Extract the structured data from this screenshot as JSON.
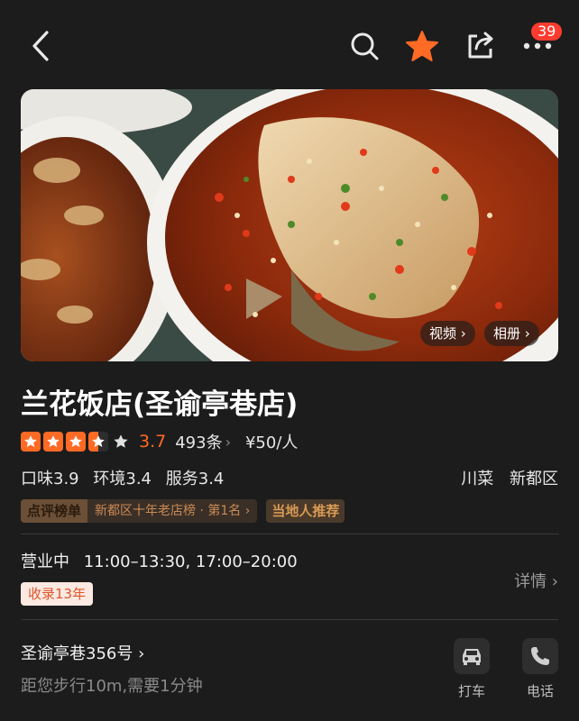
{
  "topbar": {
    "back_icon": "chevron-left-icon",
    "search_icon": "search-icon",
    "favorite_icon": "star-icon",
    "share_icon": "share-icon",
    "more_icon": "more-icon",
    "notification_count": "39",
    "accent_color": "#ff6a25"
  },
  "hero": {
    "video_label": "视频 ›",
    "album_label": "相册 ›"
  },
  "shop": {
    "name": "兰花饭店(圣谕亭巷店)",
    "stars": 3.5,
    "score": "3.7",
    "reviews": "493条",
    "price": "¥50/人",
    "taste": "口味3.9",
    "environment": "环境3.4",
    "service": "服务3.4",
    "category": "川菜",
    "district": "新都区"
  },
  "tags": {
    "rank_label": "点评榜单",
    "rank_text": "新都区十年老店榜 · 第1名 ›",
    "local_label": "当地人推荐"
  },
  "hours": {
    "status": "营业中",
    "times": "11:00–13:30, 17:00–20:00",
    "since": "收录13年",
    "details_label": "详情 ›"
  },
  "location": {
    "address": "圣谕亭巷356号 ›",
    "distance": "距您步行10m,需要1分钟",
    "taxi_label": "打车",
    "phone_label": "电话"
  }
}
